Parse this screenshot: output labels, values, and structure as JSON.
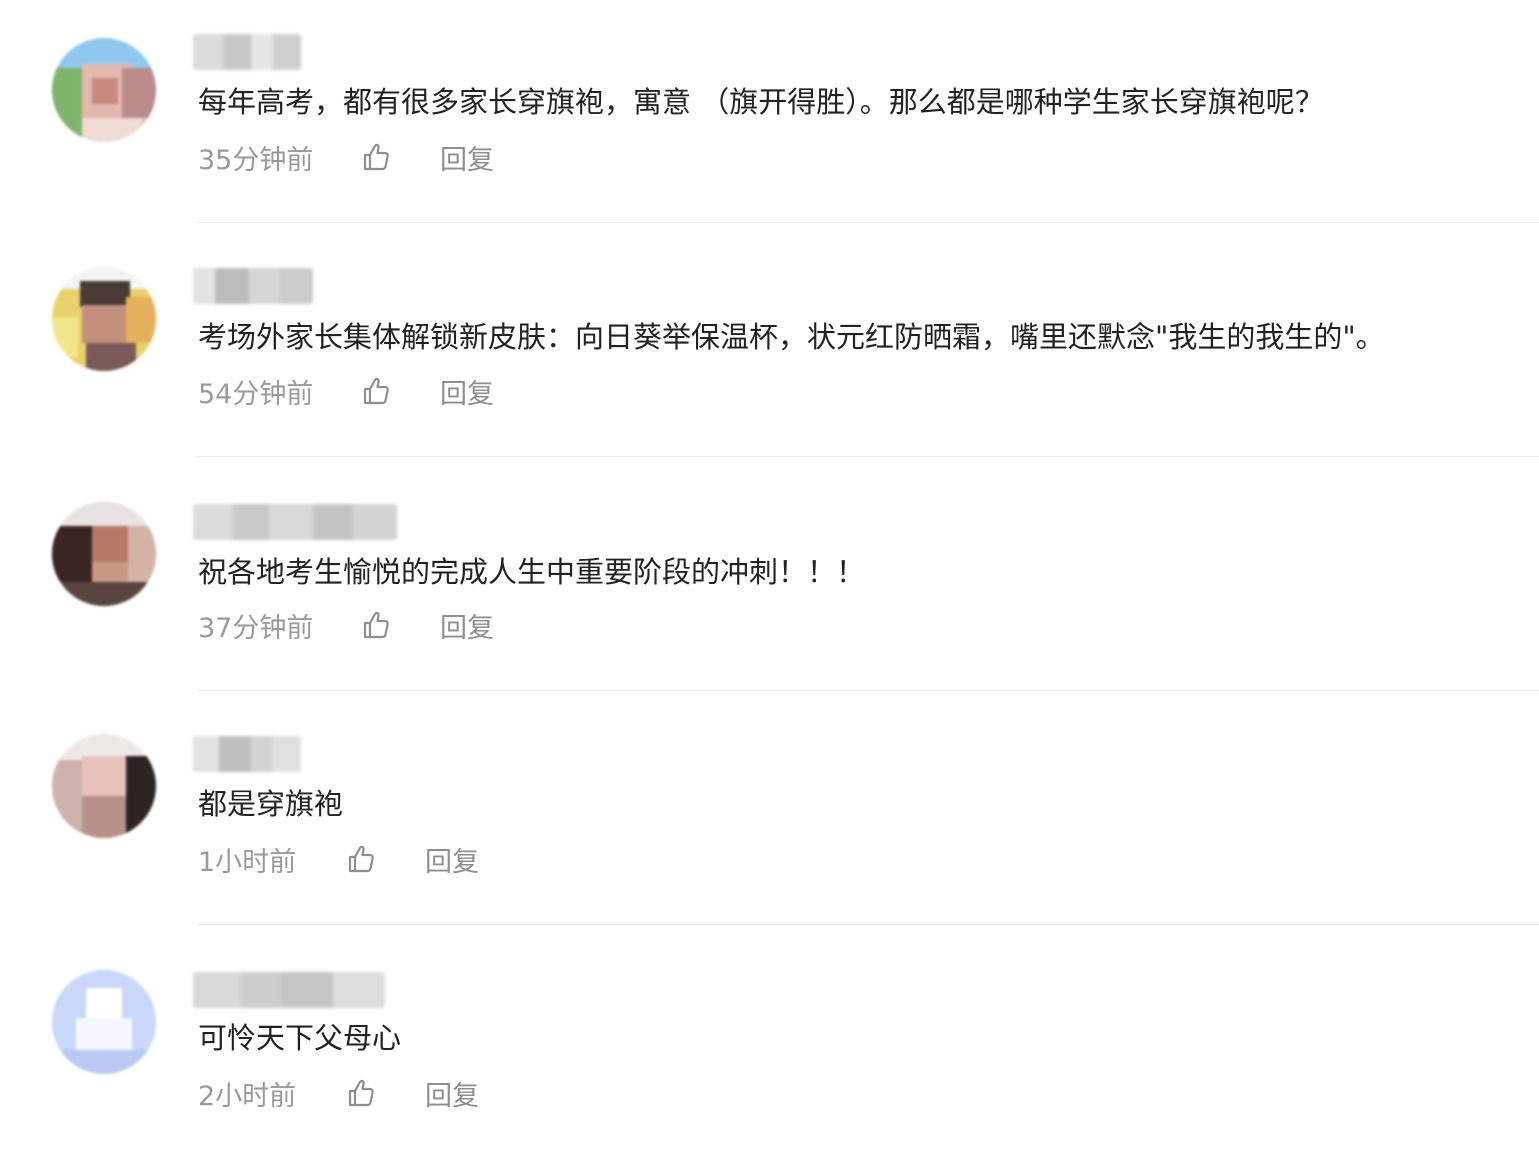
{
  "comments": [
    {
      "text": "每年高考，都有很多家长穿旗袍，寓意 （旗开得胜）。那么都是哪种学生家长穿旗袍呢？",
      "time": "35分钟前",
      "reply_label": "回复",
      "like_icon": "thumbs-up-icon"
    },
    {
      "text": "考场外家长集体解锁新皮肤：向日葵举保温杯，状元红防晒霜，嘴里还默念\"我生的我生的\"。",
      "time": "54分钟前",
      "reply_label": "回复",
      "like_icon": "thumbs-up-icon"
    },
    {
      "text": "祝各地考生愉悦的完成人生中重要阶段的冲刺！！！",
      "time": "37分钟前",
      "reply_label": "回复",
      "like_icon": "thumbs-up-icon"
    },
    {
      "text": "都是穿旗袍",
      "time": "1小时前",
      "reply_label": "回复",
      "like_icon": "thumbs-up-icon"
    },
    {
      "text": "可怜天下父母心",
      "time": "2小时前",
      "reply_label": "回复",
      "like_icon": "thumbs-up-icon"
    }
  ],
  "colors": {
    "comment_text": "#222222",
    "meta_text": "#9a9a9a",
    "divider": "#ececec",
    "background": "#ffffff"
  }
}
